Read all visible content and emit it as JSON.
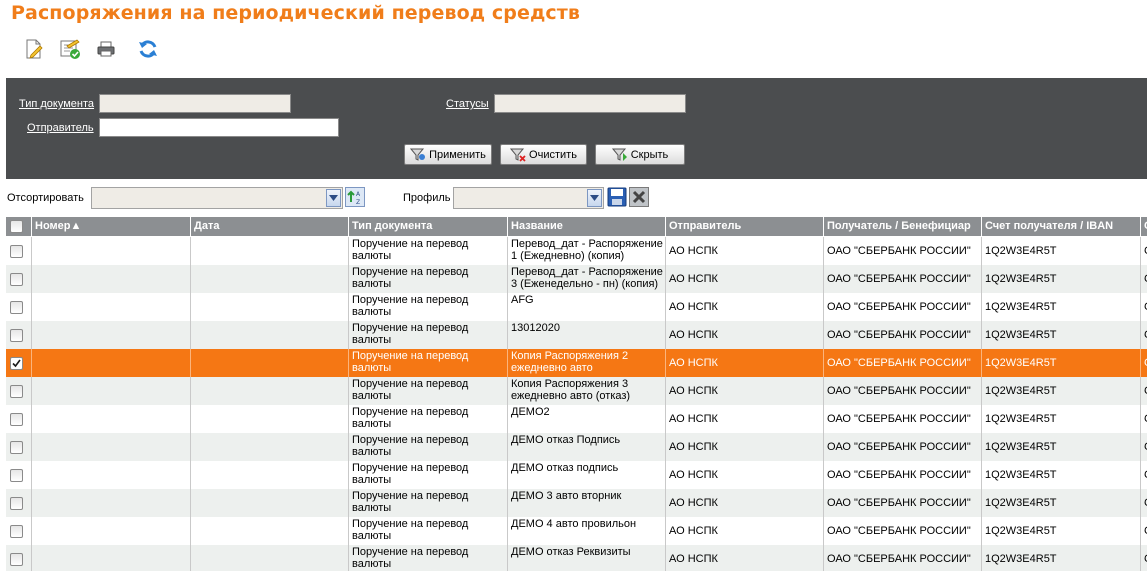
{
  "page": {
    "title": "Распоряжения на периодический перевод средств"
  },
  "toolbar": {
    "icons": [
      "new-document-icon",
      "edit-document-icon",
      "print-icon",
      "refresh-icon"
    ]
  },
  "filters": {
    "doc_type_label": "Тип документа",
    "doc_type_value": "",
    "statuses_label": "Статусы",
    "statuses_value": "",
    "sender_label": "Отправитель",
    "sender_value": "",
    "apply_label": "Применить",
    "clear_label": "Очистить",
    "hide_label": "Скрыть"
  },
  "sortbar": {
    "sort_label": "Отсортировать",
    "sort_value": "",
    "profile_label": "Профиль",
    "profile_value": ""
  },
  "grid": {
    "columns": [
      "",
      "Номер▲",
      "Дата",
      "Тип документа",
      "Название",
      "Отправитель",
      "Получатель / Бенефициар",
      "Счет получателя / IBAN",
      "С"
    ],
    "rows": [
      {
        "checked": false,
        "number": "",
        "date": "",
        "doc_type": "Поручение на перевод валюты",
        "name": "Перевод_дат - Распоряжение 1 (Ежедневно) (копия)",
        "sender": "АО НСПК",
        "recipient": "ОАО \"СБЕРБАНК РОССИИ\"",
        "account": "1Q2W3E4R5T",
        "extra": "С"
      },
      {
        "checked": false,
        "number": "",
        "date": "",
        "doc_type": "Поручение на перевод валюты",
        "name": "Перевод_дат - Распоряжение 3 (Еженедельно - пн) (копия)",
        "sender": "АО НСПК",
        "recipient": "ОАО \"СБЕРБАНК РОССИИ\"",
        "account": "1Q2W3E4R5T",
        "extra": "С"
      },
      {
        "checked": false,
        "number": "",
        "date": "",
        "doc_type": "Поручение на перевод валюты",
        "name": "AFG",
        "sender": "АО НСПК",
        "recipient": "ОАО \"СБЕРБАНК РОССИИ\"",
        "account": "1Q2W3E4R5T",
        "extra": "С"
      },
      {
        "checked": false,
        "number": "",
        "date": "",
        "doc_type": "Поручение на перевод валюты",
        "name": "13012020",
        "sender": "АО НСПК",
        "recipient": "ОАО \"СБЕРБАНК РОССИИ\"",
        "account": "1Q2W3E4R5T",
        "extra": "С"
      },
      {
        "checked": true,
        "number": "",
        "date": "",
        "doc_type": "Поручение на перевод валюты",
        "name": "Копия Распоряжения 2 ежедневно авто",
        "sender": "АО НСПК",
        "recipient": "ОАО \"СБЕРБАНК РОССИИ\"",
        "account": "1Q2W3E4R5T",
        "extra": "С"
      },
      {
        "checked": false,
        "number": "",
        "date": "",
        "doc_type": "Поручение на перевод валюты",
        "name": "Копия Распоряжения 3 ежедневно авто (отказ)",
        "sender": "АО НСПК",
        "recipient": "ОАО \"СБЕРБАНК РОССИИ\"",
        "account": "1Q2W3E4R5T",
        "extra": "С"
      },
      {
        "checked": false,
        "number": "",
        "date": "",
        "doc_type": "Поручение на перевод валюты",
        "name": "ДЕМО2",
        "sender": "АО НСПК",
        "recipient": "ОАО \"СБЕРБАНК РОССИИ\"",
        "account": "1Q2W3E4R5T",
        "extra": "С"
      },
      {
        "checked": false,
        "number": "",
        "date": "",
        "doc_type": "Поручение на перевод валюты",
        "name": "ДЕМО отказ Подпись",
        "sender": "АО НСПК",
        "recipient": "ОАО \"СБЕРБАНК РОССИИ\"",
        "account": "1Q2W3E4R5T",
        "extra": "С"
      },
      {
        "checked": false,
        "number": "",
        "date": "",
        "doc_type": "Поручение на перевод валюты",
        "name": "ДЕМО отказ подпись",
        "sender": "АО НСПК",
        "recipient": "ОАО \"СБЕРБАНК РОССИИ\"",
        "account": "1Q2W3E4R5T",
        "extra": "С"
      },
      {
        "checked": false,
        "number": "",
        "date": "",
        "doc_type": "Поручение на перевод валюты",
        "name": "ДЕМО 3 авто вторник",
        "sender": "АО НСПК",
        "recipient": "ОАО \"СБЕРБАНК РОССИИ\"",
        "account": "1Q2W3E4R5T",
        "extra": "С"
      },
      {
        "checked": false,
        "number": "",
        "date": "",
        "doc_type": "Поручение на перевод валюты",
        "name": "ДЕМО 4 авто провильон",
        "sender": "АО НСПК",
        "recipient": "ОАО \"СБЕРБАНК РОССИИ\"",
        "account": "1Q2W3E4R5T",
        "extra": "С"
      },
      {
        "checked": false,
        "number": "",
        "date": "",
        "doc_type": "Поручение на перевод валюты",
        "name": "ДЕМО отказ Реквизиты",
        "sender": "АО НСПК",
        "recipient": "ОАО \"СБЕРБАНК РОССИИ\"",
        "account": "1Q2W3E4R5T",
        "extra": "С"
      }
    ]
  },
  "colors": {
    "accent": "#f07d1a",
    "selected_row": "#f57714",
    "panel": "#4b4d4f",
    "header": "#8c8f92"
  }
}
